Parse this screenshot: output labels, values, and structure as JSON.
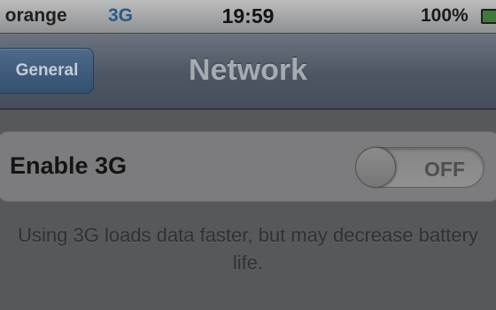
{
  "status_bar": {
    "carrier": ". orange",
    "network_type": "3G",
    "time": "19:59",
    "battery": "100%",
    "icons": [
      "signal-icon",
      "battery-icon"
    ]
  },
  "nav_bar": {
    "back_label": "General",
    "title": "Network"
  },
  "setting": {
    "label": "Enable 3G",
    "toggle_state": "OFF",
    "footer": "Using 3G loads data faster, but may decrease battery life."
  },
  "colors": {
    "network_type": "#2a5a86",
    "back_button": "#33506f",
    "battery_fill": "#3f7a3a"
  }
}
